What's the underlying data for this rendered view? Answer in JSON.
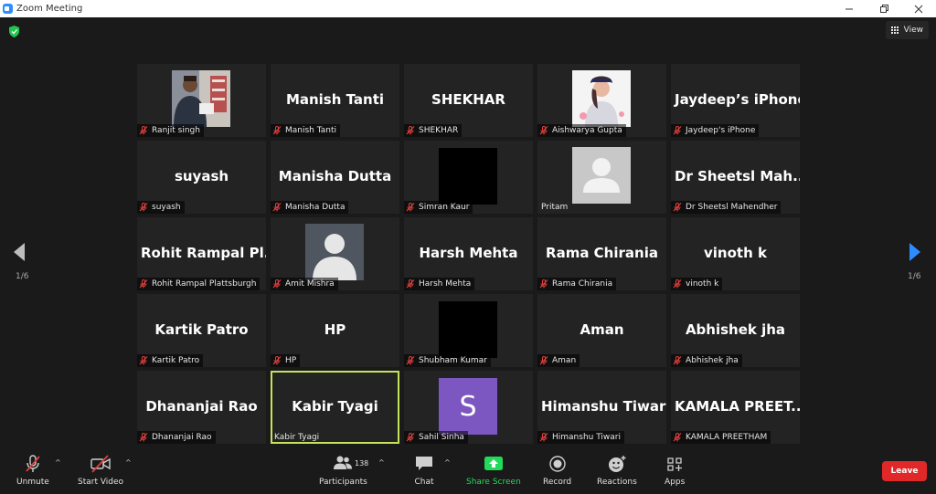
{
  "window": {
    "title": "Zoom Meeting",
    "controls": [
      "minimize",
      "maximize",
      "close"
    ]
  },
  "header": {
    "view_label": "View"
  },
  "pagination": {
    "left": "1/6",
    "right": "1/6"
  },
  "participants": [
    {
      "big": "",
      "tag": "Ranjit singh",
      "kind": "photo-man",
      "muted": true
    },
    {
      "big": "Manish Tanti",
      "tag": "Manish Tanti",
      "kind": "name",
      "muted": true
    },
    {
      "big": "SHEKHAR",
      "tag": "SHEKHAR",
      "kind": "name",
      "muted": true
    },
    {
      "big": "",
      "tag": "Aishwarya Gupta",
      "kind": "photo-woman",
      "muted": true
    },
    {
      "big": "Jaydeep’s iPhone",
      "tag": "Jaydeep's iPhone",
      "kind": "name",
      "muted": true
    },
    {
      "big": "suyash",
      "tag": "suyash",
      "kind": "name",
      "muted": true
    },
    {
      "big": "Manisha Dutta",
      "tag": "Manisha Dutta",
      "kind": "name",
      "muted": true
    },
    {
      "big": "",
      "tag": "Simran Kaur",
      "kind": "black",
      "muted": true
    },
    {
      "big": "",
      "tag": "Pritam",
      "kind": "default-avatar",
      "muted": false
    },
    {
      "big": "Dr Sheetsl Mah...",
      "tag": "Dr Sheetsl Mahendher",
      "kind": "name",
      "muted": true
    },
    {
      "big": "Rohit Rampal Pl...",
      "tag": "Rohit Rampal Plattsburgh",
      "kind": "name",
      "muted": true
    },
    {
      "big": "",
      "tag": "Amit Mishra",
      "kind": "silhouette",
      "muted": true
    },
    {
      "big": "Harsh Mehta",
      "tag": "Harsh Mehta",
      "kind": "name",
      "muted": true
    },
    {
      "big": "Rama Chirania",
      "tag": "Rama Chirania",
      "kind": "name",
      "muted": true
    },
    {
      "big": "vinoth k",
      "tag": "vinoth k",
      "kind": "name",
      "muted": true
    },
    {
      "big": "Kartik Patro",
      "tag": "Kartik Patro",
      "kind": "name",
      "muted": true
    },
    {
      "big": "HP",
      "tag": "HP",
      "kind": "name",
      "muted": true
    },
    {
      "big": "",
      "tag": "Shubham Kumar",
      "kind": "black",
      "muted": true
    },
    {
      "big": "Aman",
      "tag": "Aman",
      "kind": "name",
      "muted": true
    },
    {
      "big": "Abhishek jha",
      "tag": "Abhishek jha",
      "kind": "name",
      "muted": true
    },
    {
      "big": "Dhananjai Rao",
      "tag": "Dhananjai Rao",
      "kind": "name",
      "muted": true
    },
    {
      "big": "Kabir Tyagi",
      "tag": "Kabir Tyagi",
      "kind": "name",
      "muted": false,
      "active": true
    },
    {
      "big": "",
      "tag": "Sahil Sinha",
      "kind": "letter",
      "letter": "S",
      "muted": true
    },
    {
      "big": "Himanshu Tiwari",
      "tag": "Himanshu Tiwari",
      "kind": "name",
      "muted": true
    },
    {
      "big": "KAMALA  PREET...",
      "tag": "KAMALA PREETHAM",
      "kind": "name",
      "muted": true
    }
  ],
  "toolbar": {
    "unmute": "Unmute",
    "start_video": "Start Video",
    "participants": "Participants",
    "participants_count": "138",
    "chat": "Chat",
    "share_screen": "Share Screen",
    "record": "Record",
    "reactions": "Reactions",
    "apps": "Apps",
    "leave": "Leave"
  },
  "colors": {
    "share_green": "#23d959",
    "leave_red": "#e02828",
    "active_border": "#c5e35a",
    "mute_red": "#e0403c"
  }
}
